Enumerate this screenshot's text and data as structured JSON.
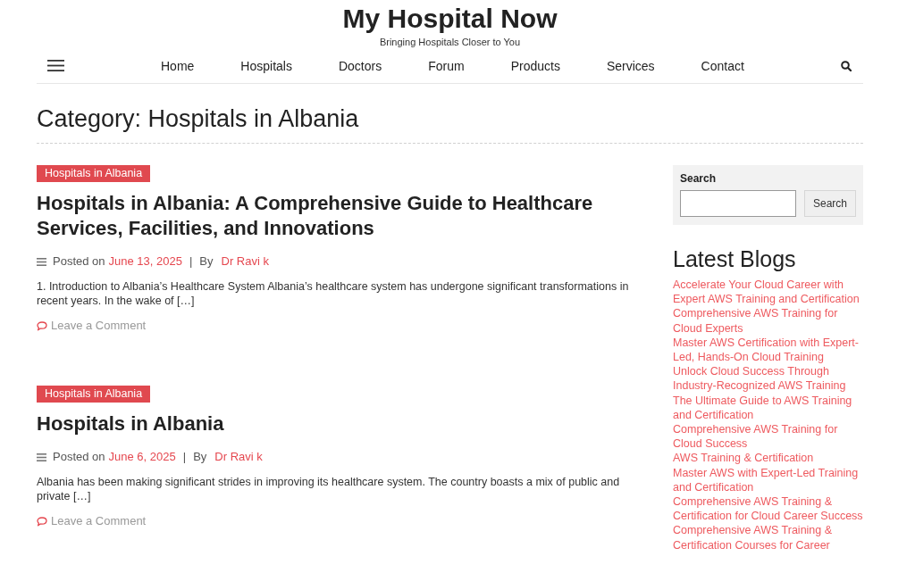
{
  "site": {
    "title": "My Hospital Now",
    "tagline": "Bringing Hospitals Closer to You"
  },
  "nav": {
    "items": [
      "Home",
      "Hospitals",
      "Doctors",
      "Forum",
      "Products",
      "Services",
      "Contact"
    ]
  },
  "page_title": "Category: Hospitals in Albania",
  "posts": [
    {
      "category": "Hospitals in Albania",
      "title": "Hospitals in Albania: A Comprehensive Guide to Healthcare Services, Facilities, and Innovations",
      "posted_label": "Posted on",
      "date": "June 13, 2025",
      "separator": "|",
      "by_label": "By",
      "author": "Dr Ravi k",
      "excerpt": "1. Introduction to Albania’s Healthcare System Albania’s healthcare system has undergone significant transformations in recent years. In the wake of […]",
      "comment_link": "Leave a Comment"
    },
    {
      "category": "Hospitals in Albania",
      "title": "Hospitals in Albania",
      "posted_label": "Posted on",
      "date": "June 6, 2025",
      "separator": "|",
      "by_label": "By",
      "author": "Dr Ravi k",
      "excerpt": "Albania has been making significant strides in improving its healthcare system. The country boasts a mix of public and private […]",
      "comment_link": "Leave a Comment"
    }
  ],
  "sidebar": {
    "search": {
      "label": "Search",
      "button": "Search"
    },
    "latest_blogs": {
      "title": "Latest Blogs",
      "items": [
        "Accelerate Your Cloud Career with Expert AWS Training and Certification",
        "Comprehensive AWS Training for Cloud Experts",
        "Master AWS Certification with Expert-Led, Hands-On Cloud Training",
        "Unlock Cloud Success Through Industry-Recognized AWS Training",
        "The Ultimate Guide to AWS Training and Certification",
        "Comprehensive AWS Training for Cloud Success",
        "AWS Training & Certification",
        "Master AWS with Expert-Led Training and Certification",
        "Comprehensive AWS Training & Certification for Cloud Career Success",
        "Comprehensive AWS Training & Certification Courses for Career"
      ]
    }
  }
}
